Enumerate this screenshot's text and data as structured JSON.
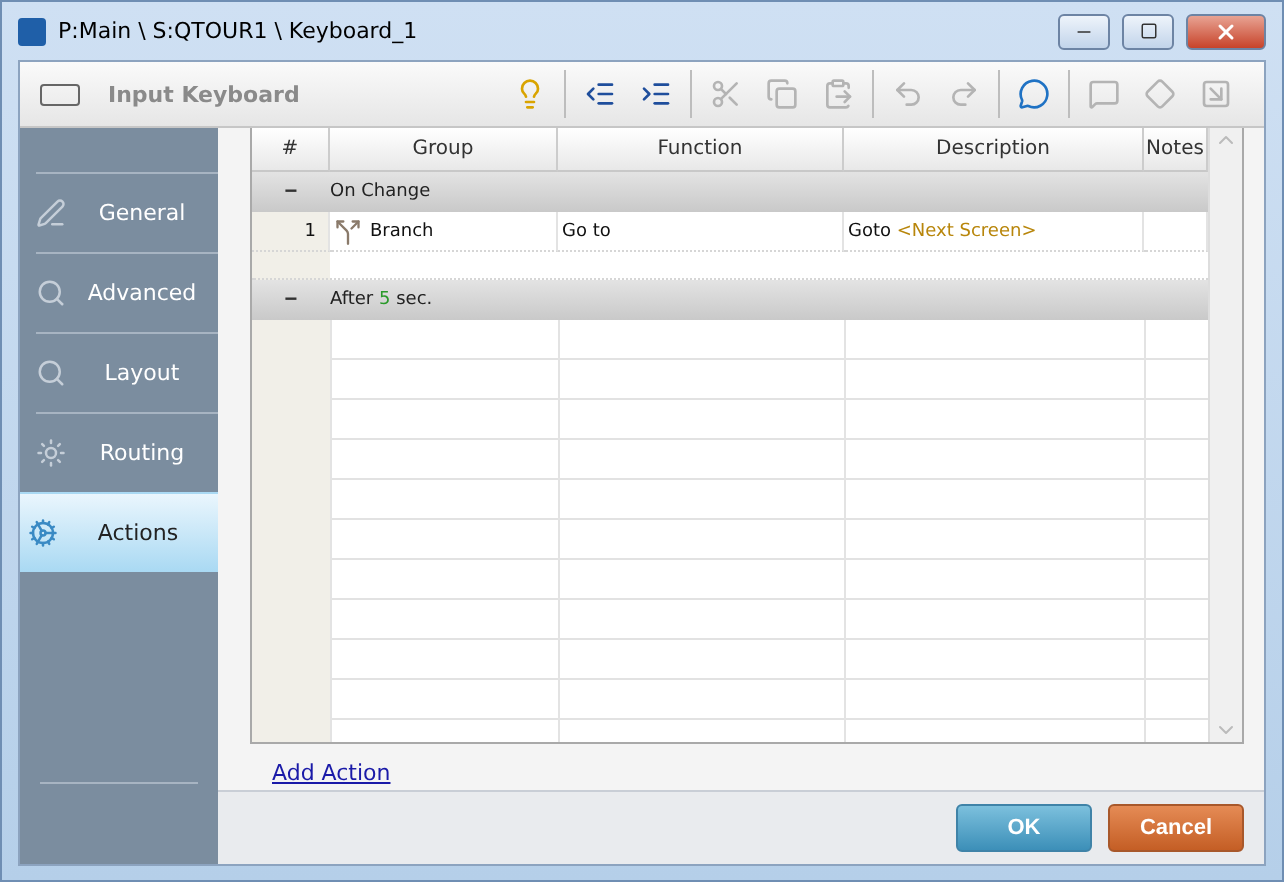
{
  "window": {
    "title": "P:Main \\ S:QTOUR1 \\ Keyboard_1"
  },
  "toolbar": {
    "title": "Input Keyboard",
    "tools": [
      {
        "kind": "bulb",
        "disabled": false
      },
      {
        "kind": "sep"
      },
      {
        "kind": "outdent",
        "disabled": false
      },
      {
        "kind": "indent",
        "disabled": false
      },
      {
        "kind": "sep"
      },
      {
        "kind": "cut",
        "disabled": true
      },
      {
        "kind": "copy",
        "disabled": true
      },
      {
        "kind": "paste",
        "disabled": true
      },
      {
        "kind": "sep"
      },
      {
        "kind": "undo",
        "disabled": true
      },
      {
        "kind": "redo",
        "disabled": true
      },
      {
        "kind": "sep"
      },
      {
        "kind": "info",
        "disabled": false
      },
      {
        "kind": "sep"
      },
      {
        "kind": "comment",
        "disabled": true
      },
      {
        "kind": "diamond",
        "disabled": true
      },
      {
        "kind": "jump",
        "disabled": true
      }
    ]
  },
  "sidebar": {
    "items": [
      {
        "label": "General",
        "kind": "general",
        "selected": false
      },
      {
        "label": "Advanced",
        "kind": "advanced",
        "selected": false
      },
      {
        "label": "Layout",
        "kind": "layout",
        "selected": false
      },
      {
        "label": "Routing",
        "kind": "routing",
        "selected": false
      },
      {
        "label": "Actions",
        "kind": "actions",
        "selected": true
      }
    ]
  },
  "table": {
    "columns": [
      "#",
      "Group",
      "Function",
      "Description",
      "Notes"
    ],
    "groups": [
      {
        "label": "On Change",
        "toggle": "−",
        "expanded": true,
        "rows": [
          {
            "number": "1",
            "group": "Branch",
            "function": "Go to",
            "description": "Goto",
            "target": "<Next Screen>"
          }
        ]
      },
      {
        "label": "After",
        "value": "5",
        "suffix": "sec.",
        "toggle": "−",
        "expanded": true
      }
    ]
  },
  "add_link": "Add Action",
  "buttons": [
    {
      "label": "OK",
      "kind": "ok"
    },
    {
      "label": "Cancel",
      "kind": "cancel"
    }
  ]
}
